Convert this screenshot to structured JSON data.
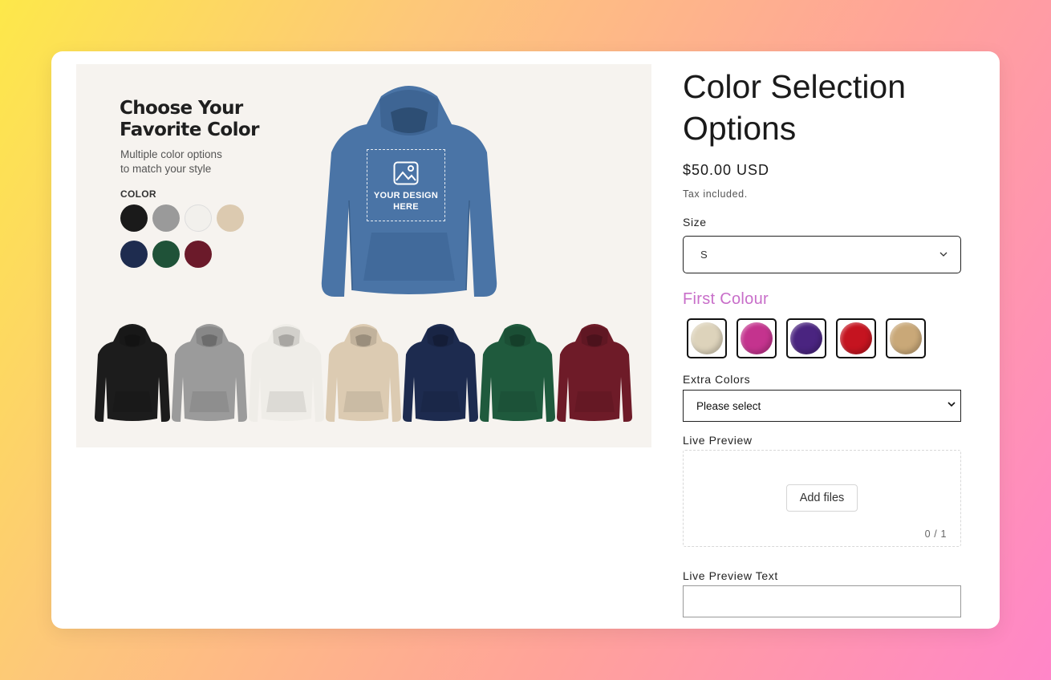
{
  "hero": {
    "title_line1": "Choose Your",
    "title_line2": "Favorite Color",
    "subtitle_line1": "Multiple color options",
    "subtitle_line2": "to match your style",
    "color_label": "COLOR",
    "dot_colors": [
      "#1a1a1a",
      "#9a9a9a",
      "#f2f0ec",
      "#dccab0",
      "#1e2c4f",
      "#1f5238",
      "#6b1a2a"
    ],
    "design_text_line1": "YOUR DESIGN",
    "design_text_line2": "HERE",
    "main_hoodie_color": "#4a74a6",
    "row_hoodie_colors": [
      "#1c1c1c",
      "#9b9b9b",
      "#efede8",
      "#dccbb2",
      "#1d2b4f",
      "#1f5a3d",
      "#6e1b28"
    ]
  },
  "product": {
    "title": "Color Selection Options",
    "price": "$50.00 USD",
    "tax_note": "Tax included."
  },
  "size": {
    "label": "Size",
    "value": "S"
  },
  "first_colour": {
    "label": "First Colour",
    "swatches": [
      "#ddd3bb",
      "#c4338e",
      "#4a2480",
      "#c51420",
      "#c9a878"
    ]
  },
  "extra_colors": {
    "label": "Extra Colors",
    "value": "Please select"
  },
  "live_preview": {
    "label": "Live Preview",
    "button": "Add files",
    "count": "0 / 1"
  },
  "live_preview_text": {
    "label": "Live Preview Text",
    "value": ""
  }
}
